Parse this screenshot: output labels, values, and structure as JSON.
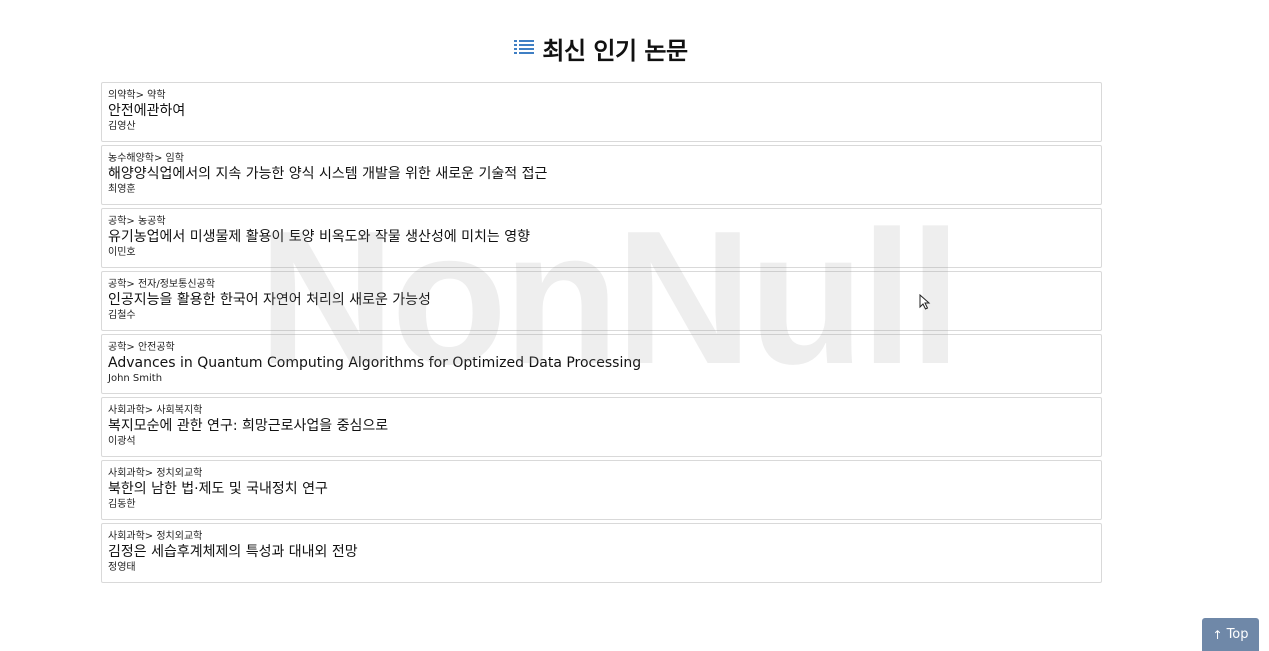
{
  "header": {
    "title": "최신 인기 논문",
    "icon": "list-icon",
    "icon_color": "#3f7fc4"
  },
  "watermark": {
    "text": "NonNull"
  },
  "papers": [
    {
      "category": "의약학> 약학",
      "title": "안전에관하여",
      "author": "김영산"
    },
    {
      "category": "농수해양학> 임학",
      "title": "해양양식업에서의 지속 가능한 양식 시스템 개발을 위한 새로운 기술적 접근",
      "author": "최영훈"
    },
    {
      "category": "공학> 농공학",
      "title": "유기농업에서 미생물제 활용이 토양 비옥도와 작물 생산성에 미치는 영향",
      "author": "이민호"
    },
    {
      "category": "공학> 전자/정보통신공학",
      "title": "인공지능을 활용한 한국어 자연어 처리의 새로운 가능성",
      "author": "김철수"
    },
    {
      "category": "공학> 안전공학",
      "title": "Advances in Quantum Computing Algorithms for Optimized Data Processing",
      "author": "John Smith"
    },
    {
      "category": "사회과학> 사회복지학",
      "title": "복지모순에 관한 연구: 희망근로사업을 중심으로",
      "author": "이광석"
    },
    {
      "category": "사회과학> 정치외교학",
      "title": "북한의 남한 법·제도 및 국내정치 연구",
      "author": "김동한"
    },
    {
      "category": "사회과학> 정치외교학",
      "title": "김정은 세습후계체제의 특성과 대내외 전망",
      "author": "정영태"
    }
  ],
  "top_button": {
    "label": "Top",
    "icon": "arrow-up-icon",
    "color": "#6f88a8"
  }
}
